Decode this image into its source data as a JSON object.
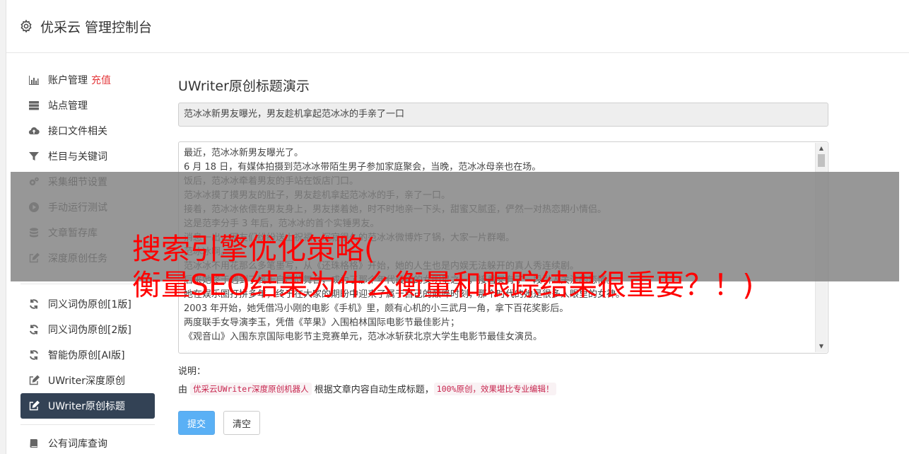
{
  "app": {
    "title": "优采云 管理控制台"
  },
  "sidebar": {
    "group1": [
      {
        "label": "账户管理",
        "extra": "充值",
        "icon": "bar-chart-icon"
      },
      {
        "label": "站点管理",
        "icon": "server-icon"
      },
      {
        "label": "接口文件相关",
        "icon": "cloud-upload-icon"
      },
      {
        "label": "栏目与关键词",
        "icon": "filter-icon"
      },
      {
        "label": "采集细节设置",
        "icon": "cogs-icon"
      },
      {
        "label": "手动运行测试",
        "icon": "play-circle-icon"
      },
      {
        "label": "文章暂存库",
        "icon": "database-icon"
      },
      {
        "label": "深度原创任务",
        "icon": "edit-icon"
      }
    ],
    "group2": [
      {
        "label": "同义词伪原创[1版]",
        "icon": "refresh-icon"
      },
      {
        "label": "同义词伪原创[2版]",
        "icon": "refresh-icon"
      },
      {
        "label": "智能伪原创[AI版]",
        "icon": "refresh-icon"
      },
      {
        "label": "UWriter深度原创",
        "icon": "edit-icon"
      },
      {
        "label": "UWriter原创标题",
        "icon": "edit-icon",
        "active": true
      }
    ],
    "group3": [
      {
        "label": "公有词库查询",
        "icon": "book-icon"
      }
    ]
  },
  "main": {
    "heading": "UWriter原创标题演示",
    "title_value": "范冰冰新男友曝光，男友趁机拿起范冰冰的手亲了一口",
    "content_lines": [
      "最近，范冰冰新男友曝光了。",
      "6 月 18 日，有媒体拍摄到范冰冰带陌生男子参加家庭聚会，当晚，范冰冰母亲也在场。",
      "饭后，范冰冰牵着男友的手站在饭店门口。",
      "范冰冰摸了摸男友的肚子，男友趁机拿起范冰冰的手，亲了一口。",
      "接着，范冰冰依偎在男友身上，男友搂着她，时不时地亲一下头，甜蜜又腻歪，俨然一对热恋期小情侣。",
      "这是范李分手 3 年后，范冰冰的首个实锤男友。",
      "消息一出，网友们纷纷送上祝福，沉寂很久的范冰冰微博炸了锅，大家一片群嘲。",
      "范冰冰啊。",
      "范冰冰不用花那么多笔墨写，从《还珠格格》开始，她的人生也是内娱无法躲开的真人秀连续剧。",
      "后来她终于遇到了属于自己的舞台，成为了那个年代最红的女明星之一，接着又有了一段引人关注的恋情。",
      "她在娱乐圈打拼多年，终于在大家的期盼中迎来了属于自己的巅峰时刻，那个时代的她是很多人眼里的女神。",
      "2003 年开始，她凭借冯小刚的电影《手机》里，颇有心机的小三武月一角，拿下百花奖影后。",
      "两度联手女导演李玉，凭借《苹果》入围柏林国际电影节最佳影片；",
      "《观音山》入围东京国际电影节主竞赛单元，范冰冰斩获北京大学生电影节最佳女演员。"
    ],
    "notes_label": "说明：",
    "notes_prefix": "由",
    "notes_code1": "优采云UWriter深度原创机器人",
    "notes_middle": "根据文章内容自动生成标题，",
    "notes_code2": "100%原创，效果堪比专业编辑！",
    "submit_label": "提交",
    "clear_label": "清空"
  },
  "overlay": {
    "line1": "搜索引擎优化策略(",
    "line2": "衡量SEO结果为什么衡量和跟踪结果很重要？！)"
  },
  "colors": {
    "accent": "#5ab0f5",
    "active_nav": "#334255",
    "highlight_red": "#e4393c",
    "overlay_text": "#ff0000"
  }
}
